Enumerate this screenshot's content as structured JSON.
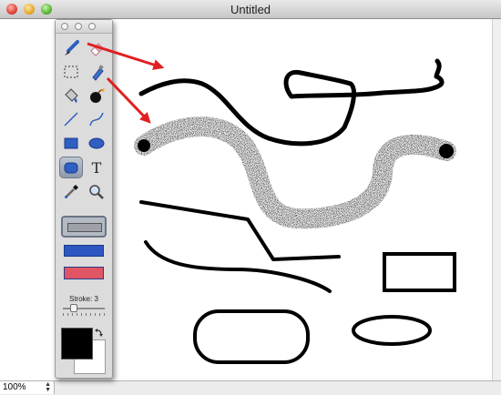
{
  "window": {
    "title": "Untitled"
  },
  "palette": {
    "tools": [
      {
        "name": "brush-tool",
        "icon": "brush-icon"
      },
      {
        "name": "eraser-tool",
        "icon": "eraser-icon"
      },
      {
        "name": "select-tool",
        "icon": "marquee-select-icon"
      },
      {
        "name": "spray-tool",
        "icon": "spray-can-icon"
      },
      {
        "name": "fill-tool",
        "icon": "paint-bucket-icon"
      },
      {
        "name": "bomb-tool",
        "icon": "bomb-icon"
      },
      {
        "name": "line-tool",
        "icon": "line-icon"
      },
      {
        "name": "curve-tool",
        "icon": "curve-icon"
      },
      {
        "name": "rectangle-tool",
        "icon": "rectangle-icon"
      },
      {
        "name": "ellipse-tool",
        "icon": "ellipse-icon"
      },
      {
        "name": "rounded-rect-tool",
        "icon": "rounded-rectangle-icon",
        "selected": true
      },
      {
        "name": "text-tool",
        "icon": "text-icon",
        "glyph": "T"
      },
      {
        "name": "eyedropper-tool",
        "icon": "eyedropper-icon"
      },
      {
        "name": "zoom-tool",
        "icon": "magnifier-icon"
      }
    ],
    "swatches": {
      "blue": "#2e56c1",
      "red": "#e05563",
      "outline": "#9ea2a8"
    },
    "stroke_label": "Stroke: 3",
    "stroke_value": 3,
    "stroke_color": "#000000",
    "fill_color": "#ffffff"
  },
  "status": {
    "zoom": "100%"
  },
  "annotation_color": "#e02020"
}
